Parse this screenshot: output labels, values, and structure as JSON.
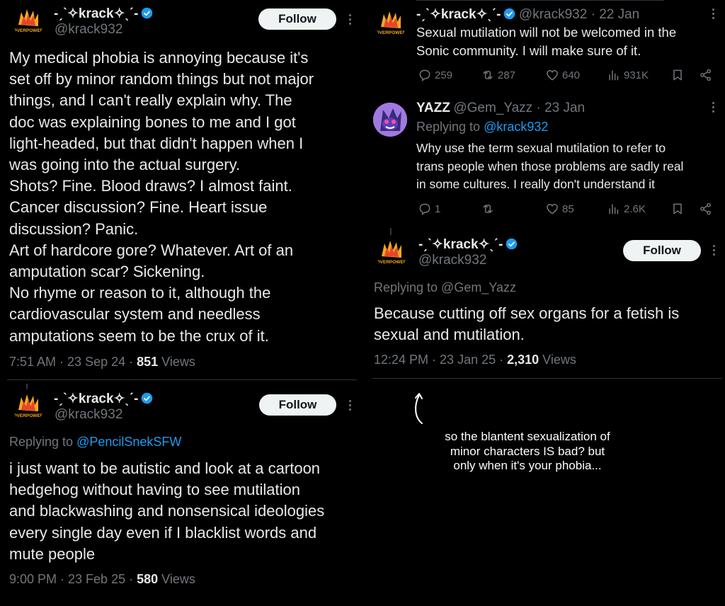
{
  "author": {
    "display_name": "-ˏˋ✧krack✧ˎˊ-",
    "handle": "@krack932",
    "avatar_text": "OVERPOWER"
  },
  "follow_label": "Follow",
  "left": {
    "tweet1": {
      "body": "My medical phobia is annoying because it's\nset off by minor random things but not major\nthings, and I can't really explain why. The\ndoc was explaining bones to me and I got\nlight-headed, but that didn't happen when I\nwas going into the actual surgery.\nShots? Fine. Blood draws? I almost faint.\nCancer discussion? Fine. Heart issue\ndiscussion? Panic.\nArt of hardcore gore? Whatever. Art of an\namputation scar? Sickening.\nNo rhyme or reason to it, although the\ncardiovascular system and needless\namputations seem to be the crux of it.",
      "time": "7:51 AM · 23 Sep 24 · ",
      "views_count": "851",
      "views_label": " Views"
    },
    "tweet2": {
      "replying_prefix": "Replying to ",
      "replying_to": "@PencilSnekSFW",
      "body": "i just want to be autistic and look at a cartoon\nhedgehog without having to see mutilation\nand blackwashing and nonsensical ideologies\nevery single day even if I blacklist words and\nmute people",
      "time": "9:00 PM · 23 Feb 25 · ",
      "views_count": "580",
      "views_label": " Views"
    }
  },
  "right": {
    "tweet1": {
      "date": " · 22 Jan",
      "body": "Sexual mutilation will not be welcomed in the\nSonic community. I will make sure of it.",
      "replies": "259",
      "reposts": "287",
      "likes": "640",
      "views": "931K"
    },
    "reply": {
      "display_name": "YAZZ",
      "handle": "@Gem_Yazz",
      "date": " · 23 Jan",
      "replying_prefix": "Replying to ",
      "replying_to": "@krack932",
      "body": "Why use the term sexual mutilation to refer to\ntrans people when those problems are sadly real\nin some cultures. I really don't understand it",
      "replies": "1",
      "reposts": "",
      "likes": "85",
      "views": "2.6K"
    },
    "tweet3": {
      "replying_text": "Replying to @Gem_Yazz",
      "body": "Because cutting off sex organs for a fetish is\nsexual and mutilation.",
      "time": "12:24 PM · 23 Jan 25 · ",
      "views_count": "2,310",
      "views_label": " Views"
    }
  },
  "annotation": "so the blantent sexualization of\nminor characters IS bad? but\nonly when it's your phobia...",
  "colors": {
    "background": "#000000",
    "text": "#e7e9ea",
    "muted": "#71767b",
    "link": "#1d9bf0",
    "verified": "#1d9bf0",
    "button_bg": "#eff3f4"
  },
  "icons": [
    "verified-badge-icon",
    "more-options-icon",
    "reply-icon",
    "repost-icon",
    "like-icon",
    "views-icon",
    "bookmark-icon",
    "share-icon",
    "curved-arrow-icon"
  ]
}
